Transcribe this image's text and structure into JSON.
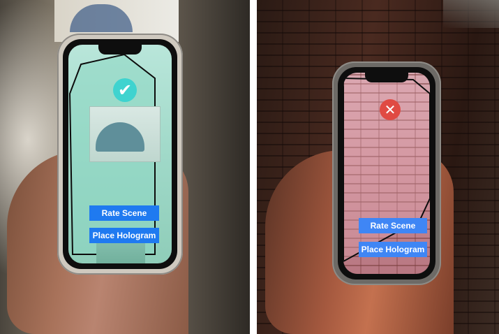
{
  "left_panel": {
    "status_icon": "checkmark-icon",
    "status_color": "#3fd3cf",
    "rate_scene_label": "Rate Scene",
    "place_hologram_label": "Place Hologram",
    "button_color": "#1f7af0"
  },
  "right_panel": {
    "status_icon": "close-x-icon",
    "status_color": "#e04a43",
    "rate_scene_label": "Rate Scene",
    "place_hologram_label": "Place Hologram",
    "button_color": "#3f86f5"
  }
}
